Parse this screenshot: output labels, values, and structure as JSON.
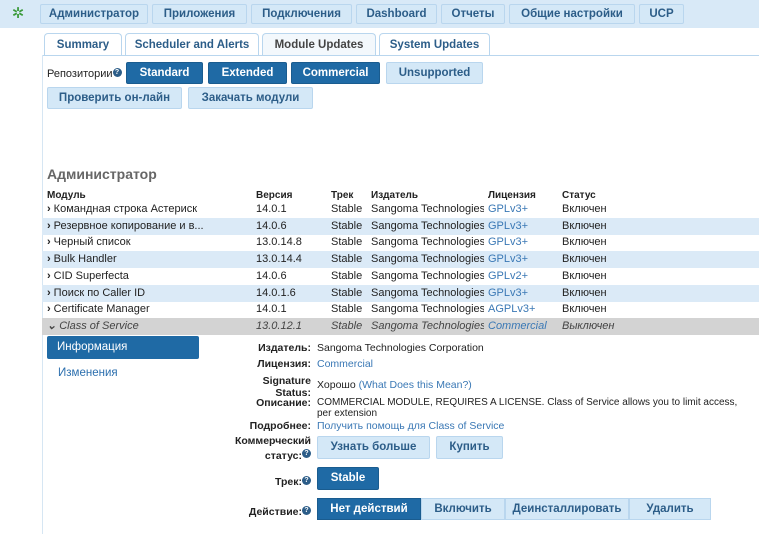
{
  "nav": {
    "items": [
      "Администратор",
      "Приложения",
      "Подключения",
      "Dashboard",
      "Отчеты",
      "Общие настройки",
      "UCP"
    ]
  },
  "tabs": [
    "Summary",
    "Scheduler and Alerts",
    "Module Updates",
    "System Updates"
  ],
  "active_tab": "Module Updates",
  "repos": {
    "label": "Репозитории",
    "buttons": [
      "Standard",
      "Extended",
      "Commercial",
      "Unsupported"
    ],
    "active": [
      "Standard",
      "Extended",
      "Commercial"
    ]
  },
  "actions": {
    "check_online": "Проверить он-лайн",
    "upload": "Закачать модули"
  },
  "section_title": "Администратор",
  "table": {
    "headers": [
      "Модуль",
      "Версия",
      "Трек",
      "Издатель",
      "Лицензия",
      "Статус"
    ],
    "rows": [
      [
        "Командная строка Астериск",
        "14.0.1",
        "Stable",
        "Sangoma Technologies",
        "GPLv3+",
        "Включен"
      ],
      [
        "Резервное копирование и в...",
        "14.0.6",
        "Stable",
        "Sangoma Technologies",
        "GPLv3+",
        "Включен"
      ],
      [
        "Черный список",
        "13.0.14.8",
        "Stable",
        "Sangoma Technologies",
        "GPLv3+",
        "Включен"
      ],
      [
        "Bulk Handler",
        "13.0.14.4",
        "Stable",
        "Sangoma Technologies",
        "GPLv3+",
        "Включен"
      ],
      [
        "CID Superfecta",
        "14.0.6",
        "Stable",
        "Sangoma Technologies",
        "GPLv2+",
        "Включен"
      ],
      [
        "Поиск по Caller ID",
        "14.0.1.6",
        "Stable",
        "Sangoma Technologies",
        "GPLv3+",
        "Включен"
      ],
      [
        "Certificate Manager",
        "14.0.1",
        "Stable",
        "Sangoma Technologies",
        "AGPLv3+",
        "Включен"
      ],
      [
        "Class of Service",
        "13.0.12.1",
        "Stable",
        "Sangoma Technologies",
        "Commercial",
        "Выключен"
      ]
    ]
  },
  "detail": {
    "side": {
      "info": "Информация",
      "changes": "Изменения"
    },
    "publisher_label": "Издатель:",
    "publisher": "Sangoma Technologies Corporation",
    "license_label": "Лицензия:",
    "license": "Commercial",
    "signature_label": "Signature Status:",
    "signature": "Хорошо",
    "signature_link": "(What Does this Mean?)",
    "description_label": "Описание:",
    "description": "COMMERCIAL MODULE, REQUIRES A LICENSE. Class of Service allows you to limit access, per extension",
    "more_label": "Подробнее:",
    "more_link": "Получить помощь для Class of Service",
    "commercial_label": "Коммерческий статус:",
    "learn_more": "Узнать больше",
    "buy": "Купить",
    "track_label": "Трек:",
    "track": "Stable",
    "action_label": "Действие:",
    "action_buttons": [
      "Нет действий",
      "Включить",
      "Деинсталлировать",
      "Удалить"
    ],
    "action_selected": "Нет действий"
  },
  "colors": {
    "primary": "#1f6aa5",
    "light": "#d4e8f7",
    "link": "#3a78b5",
    "selected_row": "#d3d3d3",
    "alt_row": "#dbeaf7"
  }
}
